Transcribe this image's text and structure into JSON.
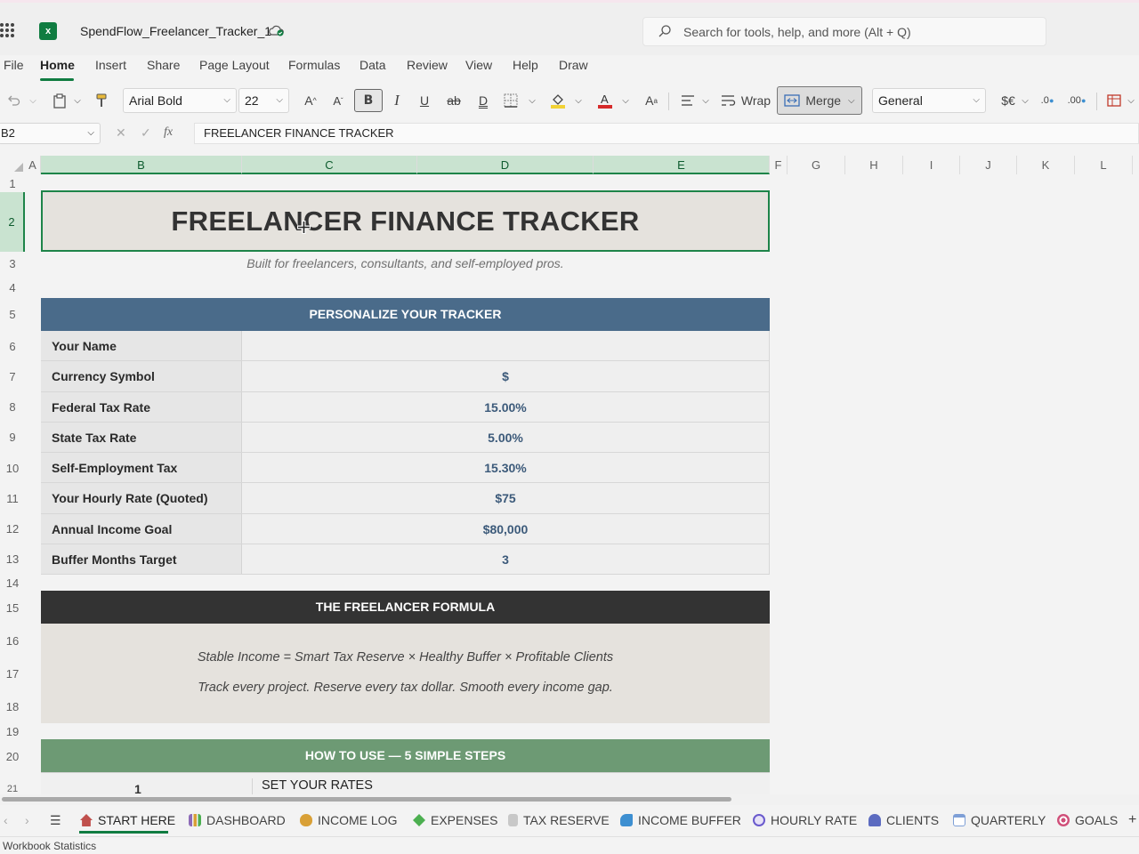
{
  "app": {
    "file_name": "SpendFlow_Freelancer_Tracker_1",
    "search_placeholder": "Search for tools, help, and more (Alt + Q)",
    "app_icon_letter": "x"
  },
  "menu": [
    "File",
    "Home",
    "Insert",
    "Share",
    "Page Layout",
    "Formulas",
    "Data",
    "Review",
    "View",
    "Help",
    "Draw"
  ],
  "ribbon": {
    "font_name": "Arial Bold",
    "font_size": "22",
    "bold": "B",
    "italic": "I",
    "underline": "U",
    "wrap_label": "Wrap",
    "merge_label": "Merge",
    "number_format": "General",
    "currency_label": "$€"
  },
  "formula_bar": {
    "name_box": "B2",
    "fx": "fx",
    "value": "FREELANCER FINANCE TRACKER"
  },
  "columns": [
    "A",
    "B",
    "C",
    "D",
    "E",
    "F",
    "G",
    "H",
    "I",
    "J",
    "K",
    "L"
  ],
  "rows": [
    "1",
    "2",
    "3",
    "4",
    "5",
    "6",
    "7",
    "8",
    "9",
    "10",
    "11",
    "12",
    "13",
    "14",
    "15",
    "16",
    "17",
    "18",
    "19",
    "20",
    "21"
  ],
  "sheet": {
    "title": "FREELANCER FINANCE TRACKER",
    "subtitle": "Built for freelancers, consultants, and self-employed pros.",
    "personalize_header": "PERSONALIZE YOUR TRACKER",
    "settings": [
      {
        "label": "Your Name",
        "value": ""
      },
      {
        "label": "Currency Symbol",
        "value": "$"
      },
      {
        "label": "Federal Tax Rate",
        "value": "15.00%"
      },
      {
        "label": "State Tax Rate",
        "value": "5.00%"
      },
      {
        "label": "Self-Employment Tax",
        "value": "15.30%"
      },
      {
        "label": "Your Hourly Rate (Quoted)",
        "value": "$75"
      },
      {
        "label": "Annual Income Goal",
        "value": "$80,000"
      },
      {
        "label": "Buffer Months Target",
        "value": "3"
      }
    ],
    "formula_header": "THE FREELANCER FORMULA",
    "formula_line": "Stable Income  =  Smart Tax Reserve  ×  Healthy Buffer  ×  Profitable Clients",
    "formula_tagline": "Track every project. Reserve every tax dollar. Smooth every income gap.",
    "steps_header": "HOW TO USE — 5 SIMPLE STEPS",
    "step1_number": "1",
    "step1_text": "SET YOUR RATES"
  },
  "tabs": [
    {
      "label": "START HERE",
      "icon": "house-icon",
      "color": "#c0504d"
    },
    {
      "label": "DASHBOARD",
      "icon": "chart-icon",
      "color": "#8e6bb8"
    },
    {
      "label": "INCOME LOG",
      "icon": "money-bag-icon",
      "color": "#d9a036"
    },
    {
      "label": "EXPENSES",
      "icon": "gem-icon",
      "color": "#4caf50"
    },
    {
      "label": "TAX RESERVE",
      "icon": "document-icon",
      "color": "#9e9e9e"
    },
    {
      "label": "INCOME BUFFER",
      "icon": "wave-icon",
      "color": "#3d8fd1"
    },
    {
      "label": "HOURLY RATE",
      "icon": "stopwatch-icon",
      "color": "#6a5acd"
    },
    {
      "label": "CLIENTS",
      "icon": "people-icon",
      "color": "#5c6bc0"
    },
    {
      "label": "QUARTERLY",
      "icon": "calendar-icon",
      "color": "#7e9fd6"
    },
    {
      "label": "GOALS",
      "icon": "target-icon",
      "color": "#d0507a"
    }
  ],
  "status": {
    "left": "Workbook Statistics"
  },
  "colors": {
    "accent": "#107c41",
    "personalize_bar": "#4a6b8a",
    "formula_bar": "#333333",
    "steps_bar": "#6d9a74",
    "title_fill": "#e5e2dd"
  }
}
